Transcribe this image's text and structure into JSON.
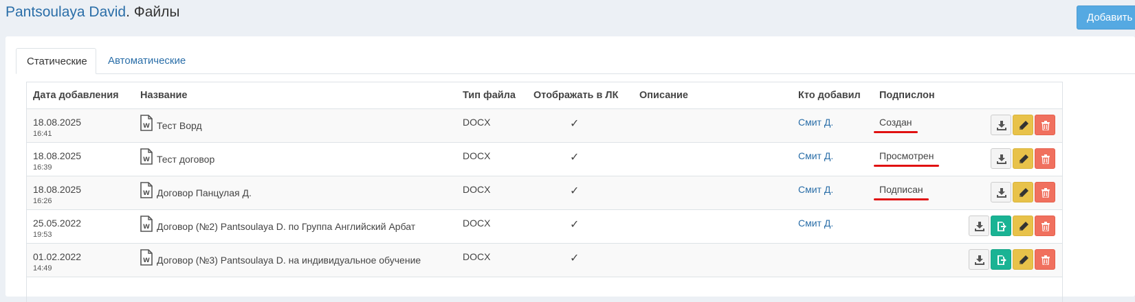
{
  "header": {
    "name": "Pantsoulaya David",
    "suffix": ". Файлы"
  },
  "toolbar": {
    "add_label": "Добавить"
  },
  "tabs": [
    {
      "label": "Статические",
      "active": true
    },
    {
      "label": "Автоматические",
      "active": false
    }
  ],
  "table": {
    "columns": [
      "Дата добавления",
      "Название",
      "Тип файла",
      "Отображать в ЛК",
      "Описание",
      "Кто добавил",
      "Подпислон",
      ""
    ],
    "rows": [
      {
        "date": "18.08.2025",
        "time": "16:41",
        "name": "Тест Ворд",
        "type": "DOCX",
        "show": "✓",
        "description": "",
        "author": "Смит Д.",
        "status": "Создан",
        "send": false
      },
      {
        "date": "18.08.2025",
        "time": "16:39",
        "name": "Тест договор",
        "type": "DOCX",
        "show": "✓",
        "description": "",
        "author": "Смит Д.",
        "status": "Просмотрен",
        "send": false
      },
      {
        "date": "18.08.2025",
        "time": "16:26",
        "name": "Договор Панцулая Д.",
        "type": "DOCX",
        "show": "✓",
        "description": "",
        "author": "Смит Д.",
        "status": "Подписан",
        "send": false
      },
      {
        "date": "25.05.2022",
        "time": "19:53",
        "name": "Договор (№2) Pantsoulaya D. по Группа Английский Арбат",
        "type": "DOCX",
        "show": "✓",
        "description": "",
        "author": "Смит Д.",
        "status": "",
        "send": true
      },
      {
        "date": "01.02.2022",
        "time": "14:49",
        "name": "Договор (№3) Pantsoulaya D. на индивидуальное обучение",
        "type": "DOCX",
        "show": "✓",
        "description": "",
        "author": "",
        "status": "",
        "send": true
      }
    ]
  },
  "colors": {
    "link": "#2a6ea8",
    "add_button": "#55a9e2",
    "send": "#1ab394",
    "edit": "#e8c24a",
    "delete": "#f0705e",
    "status_underline": "#e01010"
  }
}
